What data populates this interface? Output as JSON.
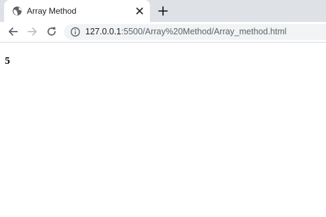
{
  "browser": {
    "tab": {
      "title": "Array Method",
      "favicon": "globe-icon"
    },
    "toolbar": {
      "back_icon": "back-arrow-icon",
      "forward_icon": "forward-arrow-icon",
      "reload_icon": "reload-icon",
      "site_info_icon": "info-icon",
      "url_host": "127.0.0.1",
      "url_path": ":5500/Array%20Method/Array_method.html"
    },
    "new_tab_icon": "plus-icon"
  },
  "page": {
    "output_text": "5"
  },
  "colors": {
    "tabstrip": "#dee1e6",
    "omnibox": "#f1f3f4",
    "icon": "#5f6368",
    "forward_disabled": "#bdc1c6"
  }
}
